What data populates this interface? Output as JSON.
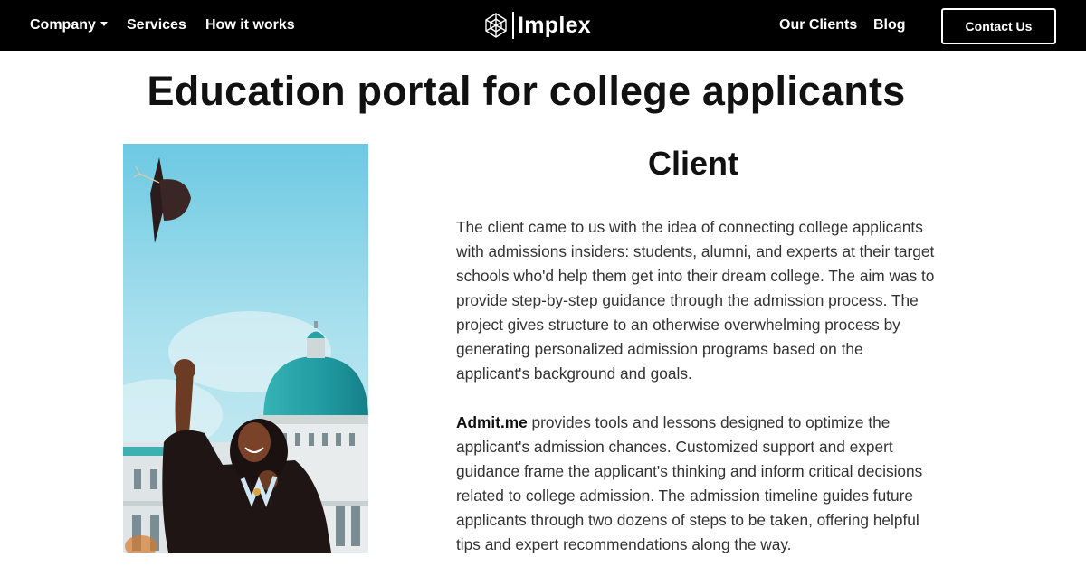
{
  "nav": {
    "company": "Company",
    "services": "Services",
    "how_it_works": "How it works",
    "logo_text": "Implex",
    "our_clients": "Our Clients",
    "blog": "Blog",
    "contact": "Contact Us"
  },
  "page": {
    "title": "Education portal for college applicants"
  },
  "client": {
    "heading": "Client",
    "paragraph1": "The client came to us with the idea of connecting college applicants with admissions insiders: students, alumni, and experts at their target schools who'd help them get into their dream college. The aim was to provide step-by-step guidance through the admission process. The project gives structure to an otherwise overwhelming process by generating personalized admission programs based on the applicant's background and goals.",
    "brand": "Admit.me",
    "paragraph2_rest": " provides tools and lessons designed to optimize the applicant's admission chances. Customized support and expert guidance frame the applicant's thinking and inform critical decisions related to college admission. The admission timeline guides future applicants through two dozens of steps to be taken, offering helpful tips and expert recommendations along the way."
  },
  "colors": {
    "nav_bg": "#000000",
    "sky": "#7fd0e6",
    "dome": "#2aa3a8"
  },
  "icons": {
    "logo": "implex-logo-icon",
    "company_caret": "chevron-down-icon"
  }
}
